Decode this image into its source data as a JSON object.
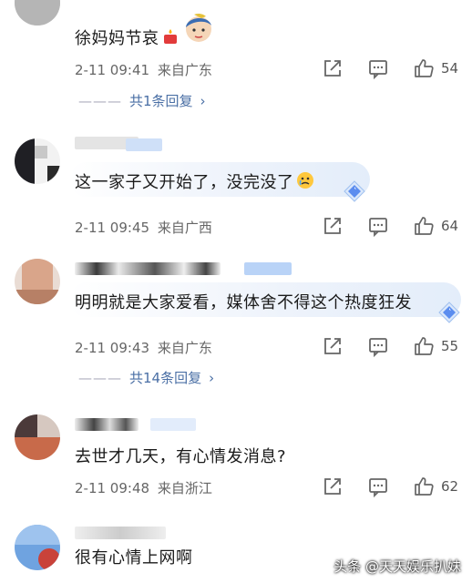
{
  "comments": [
    {
      "text": "徐妈妈节哀",
      "date": "2-11 09:41",
      "location": "来自广东",
      "likes": "54",
      "replies": "共1条回复"
    },
    {
      "text": "这一家子又开始了，没完没了",
      "date": "2-11 09:45",
      "location": "来自广西",
      "likes": "64"
    },
    {
      "text": "明明就是大家爱看，媒体舍不得这个热度狂发",
      "date": "2-11 09:43",
      "location": "来自广东",
      "likes": "55",
      "replies": "共14条回复"
    },
    {
      "text": "去世才几天，有心情发消息?",
      "date": "2-11 09:48",
      "location": "来自浙江",
      "likes": "62"
    },
    {
      "text": "很有心情上网啊"
    }
  ],
  "icons": {
    "share": "share-icon",
    "comment": "comment-icon",
    "like": "thumbs-up-icon",
    "reply_chevron": "chevron-right-icon"
  },
  "watermark": "头条 @天天娱乐扒妹",
  "colors": {
    "reply_link": "#4a6fa5",
    "meta_text": "#666666",
    "badge_blue": "#5b8def"
  }
}
